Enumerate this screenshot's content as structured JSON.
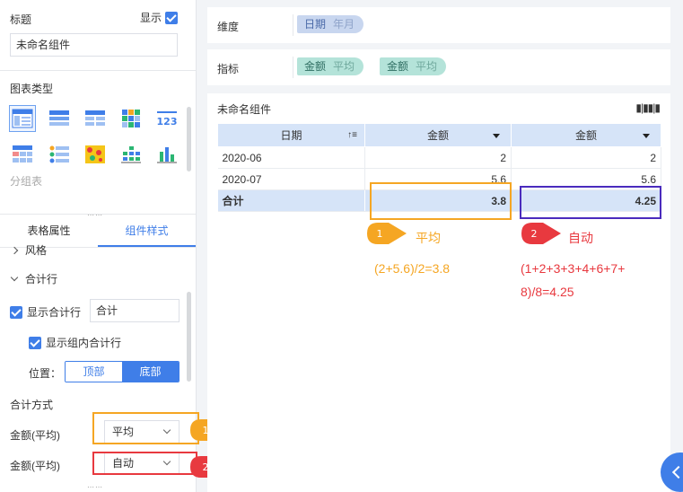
{
  "left_panel": {
    "title_label": "标题",
    "show_label": "显示",
    "title_value": "未命名组件",
    "chart_type_label": "图表类型",
    "group_table_label": "分组表",
    "chart_icons": [
      "group-table-icon",
      "cross-table-icon",
      "detail-table-icon",
      "heatmap-table-icon",
      "kpi-number-icon",
      "multi-indicator-table-icon",
      "color-table-icon",
      "scatter-map-icon",
      "stacked-bar-icon",
      "column-chart-icon"
    ],
    "tabs": [
      "表格属性",
      "组件样式"
    ],
    "style_label": "风格",
    "total_row_label": "合计行",
    "show_total_row_label": "显示合计行",
    "total_row_value": "合计",
    "show_group_total_label": "显示组内合计行",
    "position_label": "位置：",
    "position_options": [
      "顶部",
      "底部"
    ],
    "total_method_label": "合计方式",
    "methods": [
      {
        "field": "金额(平均)",
        "value": "平均",
        "badge": "1"
      },
      {
        "field": "金额(平均)",
        "value": "自动",
        "badge": "2"
      }
    ]
  },
  "dimension_bar": {
    "label": "维度",
    "pills": [
      {
        "name": "日期",
        "sub": "年月"
      }
    ]
  },
  "measure_bar": {
    "label": "指标",
    "pills": [
      {
        "name": "金额",
        "sub": "平均"
      },
      {
        "name": "金额",
        "sub": "平均"
      }
    ]
  },
  "widget": {
    "title": "未命名组件",
    "table": {
      "headers": [
        "日期",
        "金额",
        "金额"
      ],
      "rows": [
        [
          "2020-06",
          "2",
          "2"
        ],
        [
          "2020-07",
          "5.6",
          "5.6"
        ]
      ],
      "total": [
        "合计",
        "3.8",
        "4.25"
      ]
    }
  },
  "annotations": {
    "orange_label": "平均",
    "orange_badge": "1",
    "orange_formula": "(2+5.6)/2=3.8",
    "red_label": "自动",
    "red_badge": "2",
    "red_formula_line1": "(1+2+3+3+4+6+7+",
    "red_formula_line2": "8)/8=4.25"
  },
  "colors": {
    "accent": "#3f7ee8",
    "orange": "#f5a623",
    "red": "#e8393f",
    "purple": "#4a2bbd",
    "header_bg": "#d6e4f8"
  }
}
